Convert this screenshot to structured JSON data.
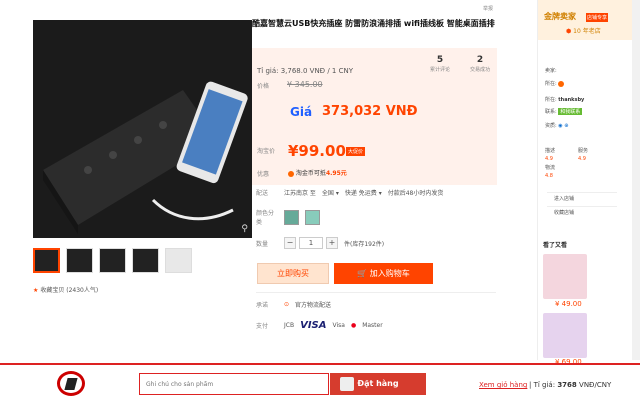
{
  "header": {
    "report": "举报"
  },
  "product": {
    "title": "酷嘉智慧云USB快充插座 防雷防浪涌排插 wifi插线板 智能桌面插排",
    "exchange_rate_label": "Tỉ giá:",
    "exchange_rate": "3,768.0 VNĐ / 1 CNY",
    "price_label": "价格",
    "old_price": "¥ 345.00",
    "gia_label": "Giá",
    "gia_value": "373,032 VNĐ",
    "promo_label": "淘宝价",
    "promo_price": "¥99.00",
    "promo_badge": "大促价",
    "reviews_count": "5",
    "reviews_label": "累计评论",
    "sales_count": "2",
    "sales_label": "交易成功",
    "benefit_label": "优惠",
    "benefit_text": "淘金币可抵",
    "benefit_value": "4.95元"
  },
  "shipping": {
    "label": "配送",
    "from": "江苏南京 至",
    "to": "全国",
    "fee": "快递 免运费",
    "time": "付款后48小时内发货"
  },
  "color": {
    "label": "颜色分类"
  },
  "quantity": {
    "label": "数量",
    "value": "1",
    "minus": "−",
    "plus": "+",
    "stock": "件(库存192件)"
  },
  "actions": {
    "buy_now": "立即购买",
    "add_cart": "加入购物车"
  },
  "promise": {
    "label": "承诺",
    "text": "官方物流配送"
  },
  "payment": {
    "label": "支付",
    "methods": [
      "JCB",
      "VISA",
      "Visa",
      "Master"
    ]
  },
  "gallery": {
    "favorite": "收藏宝贝",
    "popularity": "(2430人气)"
  },
  "seller": {
    "gold_label": "金牌卖家",
    "gold_tag": "店铺专享",
    "years": "10 年老店",
    "seller_label": "卖家:",
    "seller_name": "thanksby",
    "location_label": "所在:",
    "contact_label": "联系:",
    "contact_text": "和我联系",
    "qual_label": "资质:",
    "desc_label": "描述",
    "desc_score": "4.9",
    "service_label": "服务",
    "service_score": "4.9",
    "logistics_label": "物流",
    "logistics_score": "4.8",
    "enter_shop": "进入店铺",
    "favorite_shop": "收藏店铺",
    "look_label": "看了又看",
    "rec1_price": "¥ 49.00",
    "rec2_price": "¥ 69.00"
  },
  "footer": {
    "search_placeholder": "Ghi chú cho sản phẩm",
    "order_button": "Đặt hàng",
    "view_cart": "Xem giỏ hàng",
    "rate_label": "| Tỉ giá:",
    "rate_value": "3768",
    "rate_unit": "VNĐ/CNY"
  }
}
